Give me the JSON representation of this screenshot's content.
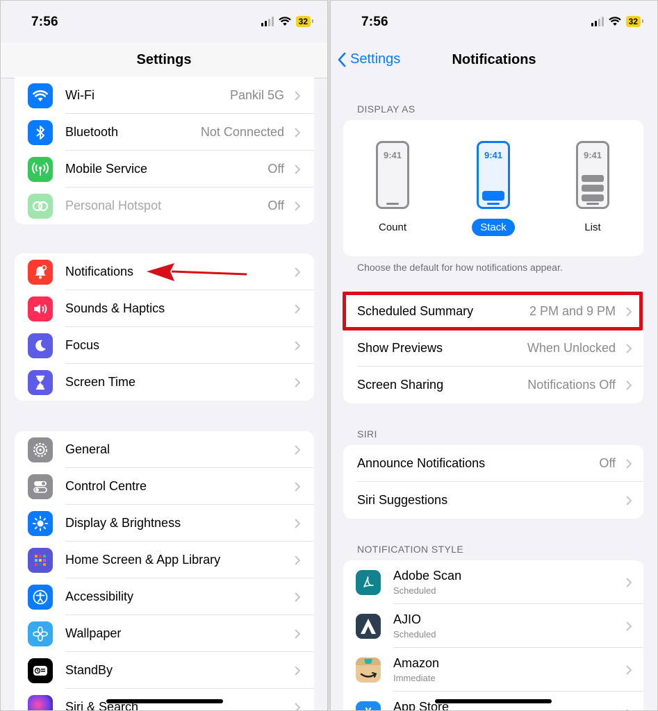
{
  "left": {
    "status": {
      "time": "7:56",
      "battery": "32"
    },
    "nav_title": "Settings",
    "group1": [
      {
        "label": "Wi-Fi",
        "value": "Pankil 5G",
        "icon": "wifi-icon",
        "color": "#0a7aff"
      },
      {
        "label": "Bluetooth",
        "value": "Not Connected",
        "icon": "bluetooth-icon",
        "color": "#0a7aff"
      },
      {
        "label": "Mobile Service",
        "value": "Off",
        "icon": "antenna-icon",
        "color": "#34c759"
      },
      {
        "label": "Personal Hotspot",
        "value": "Off",
        "icon": "hotspot-icon",
        "color": "#9ee6ae"
      }
    ],
    "group2": [
      {
        "label": "Notifications",
        "icon": "bell-icon",
        "color": "#ff3b30"
      },
      {
        "label": "Sounds & Haptics",
        "icon": "speaker-icon",
        "color": "#ff2d55"
      },
      {
        "label": "Focus",
        "icon": "moon-icon",
        "color": "#5e5ce6"
      },
      {
        "label": "Screen Time",
        "icon": "hourglass-icon",
        "color": "#5e5ce6"
      }
    ],
    "group3": [
      {
        "label": "General",
        "icon": "gear-icon",
        "color": "#8e8e93"
      },
      {
        "label": "Control Centre",
        "icon": "toggles-icon",
        "color": "#8e8e93"
      },
      {
        "label": "Display & Brightness",
        "icon": "sun-icon",
        "color": "#0a7aff"
      },
      {
        "label": "Home Screen & App Library",
        "icon": "app-grid-icon",
        "color": "#5856d6"
      },
      {
        "label": "Accessibility",
        "icon": "accessibility-icon",
        "color": "#0a7aff"
      },
      {
        "label": "Wallpaper",
        "icon": "flower-icon",
        "color": "#35aaf0"
      },
      {
        "label": "StandBy",
        "icon": "standby-icon",
        "color": "#000000"
      },
      {
        "label": "Siri & Search",
        "icon": "siri-icon",
        "color": "#222222"
      }
    ]
  },
  "right": {
    "status": {
      "time": "7:56",
      "battery": "32"
    },
    "back_label": "Settings",
    "nav_title": "Notifications",
    "display_as": {
      "header": "DISPLAY AS",
      "options": [
        {
          "label": "Count",
          "time": "9:41"
        },
        {
          "label": "Stack",
          "time": "9:41"
        },
        {
          "label": "List",
          "time": "9:41"
        }
      ],
      "selected": "Stack",
      "footnote": "Choose the default for how notifications appear."
    },
    "group1": [
      {
        "label": "Scheduled Summary",
        "value": "2 PM and 9 PM"
      },
      {
        "label": "Show Previews",
        "value": "When Unlocked"
      },
      {
        "label": "Screen Sharing",
        "value": "Notifications Off"
      }
    ],
    "siri": {
      "header": "SIRI",
      "rows": [
        {
          "label": "Announce Notifications",
          "value": "Off"
        },
        {
          "label": "Siri Suggestions",
          "value": ""
        }
      ]
    },
    "style": {
      "header": "NOTIFICATION STYLE",
      "apps": [
        {
          "name": "Adobe Scan",
          "sub": "Scheduled",
          "icon": "adobe-scan-icon",
          "color": "#12828f"
        },
        {
          "name": "AJIO",
          "sub": "Scheduled",
          "icon": "ajio-icon",
          "color": "#2c3e50"
        },
        {
          "name": "Amazon",
          "sub": "Immediate",
          "icon": "amazon-icon",
          "color": "#e9c896"
        },
        {
          "name": "App Store",
          "sub": "",
          "icon": "app-store-icon",
          "color": "#1c8cf5"
        }
      ]
    }
  }
}
